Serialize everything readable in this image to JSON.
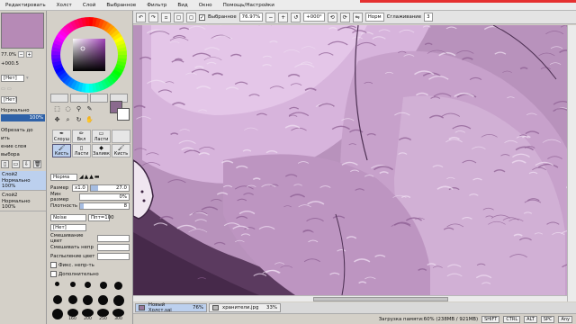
{
  "menu": [
    "Редактировать",
    "Холст",
    "Слой",
    "Выбранное",
    "Фильтр",
    "Вид",
    "Окно",
    "Помощь/Настройки"
  ],
  "toolbar": {
    "selection_label": "Выбранное",
    "zoom": "76.97%",
    "angle": "+000°",
    "mode": "Норм",
    "smoothing_label": "Сглаживание",
    "smoothing_value": "3"
  },
  "nav": {
    "zoom": "77.0%",
    "angle": "+000.5",
    "blend_a": "[Нет]",
    "blend_b": "[Нет]",
    "mode": "Нормально",
    "opacity": "100%",
    "lines": [
      "Обрезать до",
      "ить",
      "ение слоя",
      "выбора"
    ]
  },
  "layers": [
    {
      "name": "Слой2",
      "mode": "Нормально",
      "opacity": "100%"
    },
    {
      "name": "Слой2",
      "mode": "Нормально",
      "opacity": "100%"
    }
  ],
  "tools": {
    "brushes": [
      {
        "label": "Слоуш"
      },
      {
        "label": "Вкл"
      },
      {
        "label": "Ласти"
      },
      {
        "label": ""
      },
      {
        "label": "Кисть"
      },
      {
        "label": "Ласти"
      },
      {
        "label": "Заливк"
      },
      {
        "label": "Кисть"
      }
    ],
    "blend_mode": "Норма",
    "size_label": "Размер",
    "size_mult": "x1.0",
    "size_value": "27.0",
    "min_size_label": "Мин размер",
    "min_size_value": "0%",
    "density_label": "Плотность",
    "density_value": "8",
    "shape": "Noise",
    "texture": "[Нет]",
    "brush_mix_label": "Смешивание цвет",
    "brush_blend_label": "Смешивать непр",
    "brush_spread_label": "Распыление цвет",
    "fix_label": "Фикс. непр-ть",
    "extra_label": "Дополнительно",
    "dot_sizes": [
      "",
      "",
      "",
      "",
      "",
      "",
      "",
      "",
      "",
      "",
      "",
      "160",
      "200",
      "250",
      "300"
    ]
  },
  "tabs": [
    {
      "name": "Новый Холст.sai",
      "percent": "76%"
    },
    {
      "name": "хранители.jpg",
      "percent": "33%"
    }
  ],
  "status": {
    "memory": "Загрузка памяти:60% (238MB / 921MB)",
    "keys": [
      "SHIFT",
      "CTRL",
      "ALT",
      "SPC",
      "Any"
    ]
  },
  "colors": {
    "canvas_bg": "#b892bc",
    "accent": "#e53030",
    "selection": "#bcd0ee"
  }
}
